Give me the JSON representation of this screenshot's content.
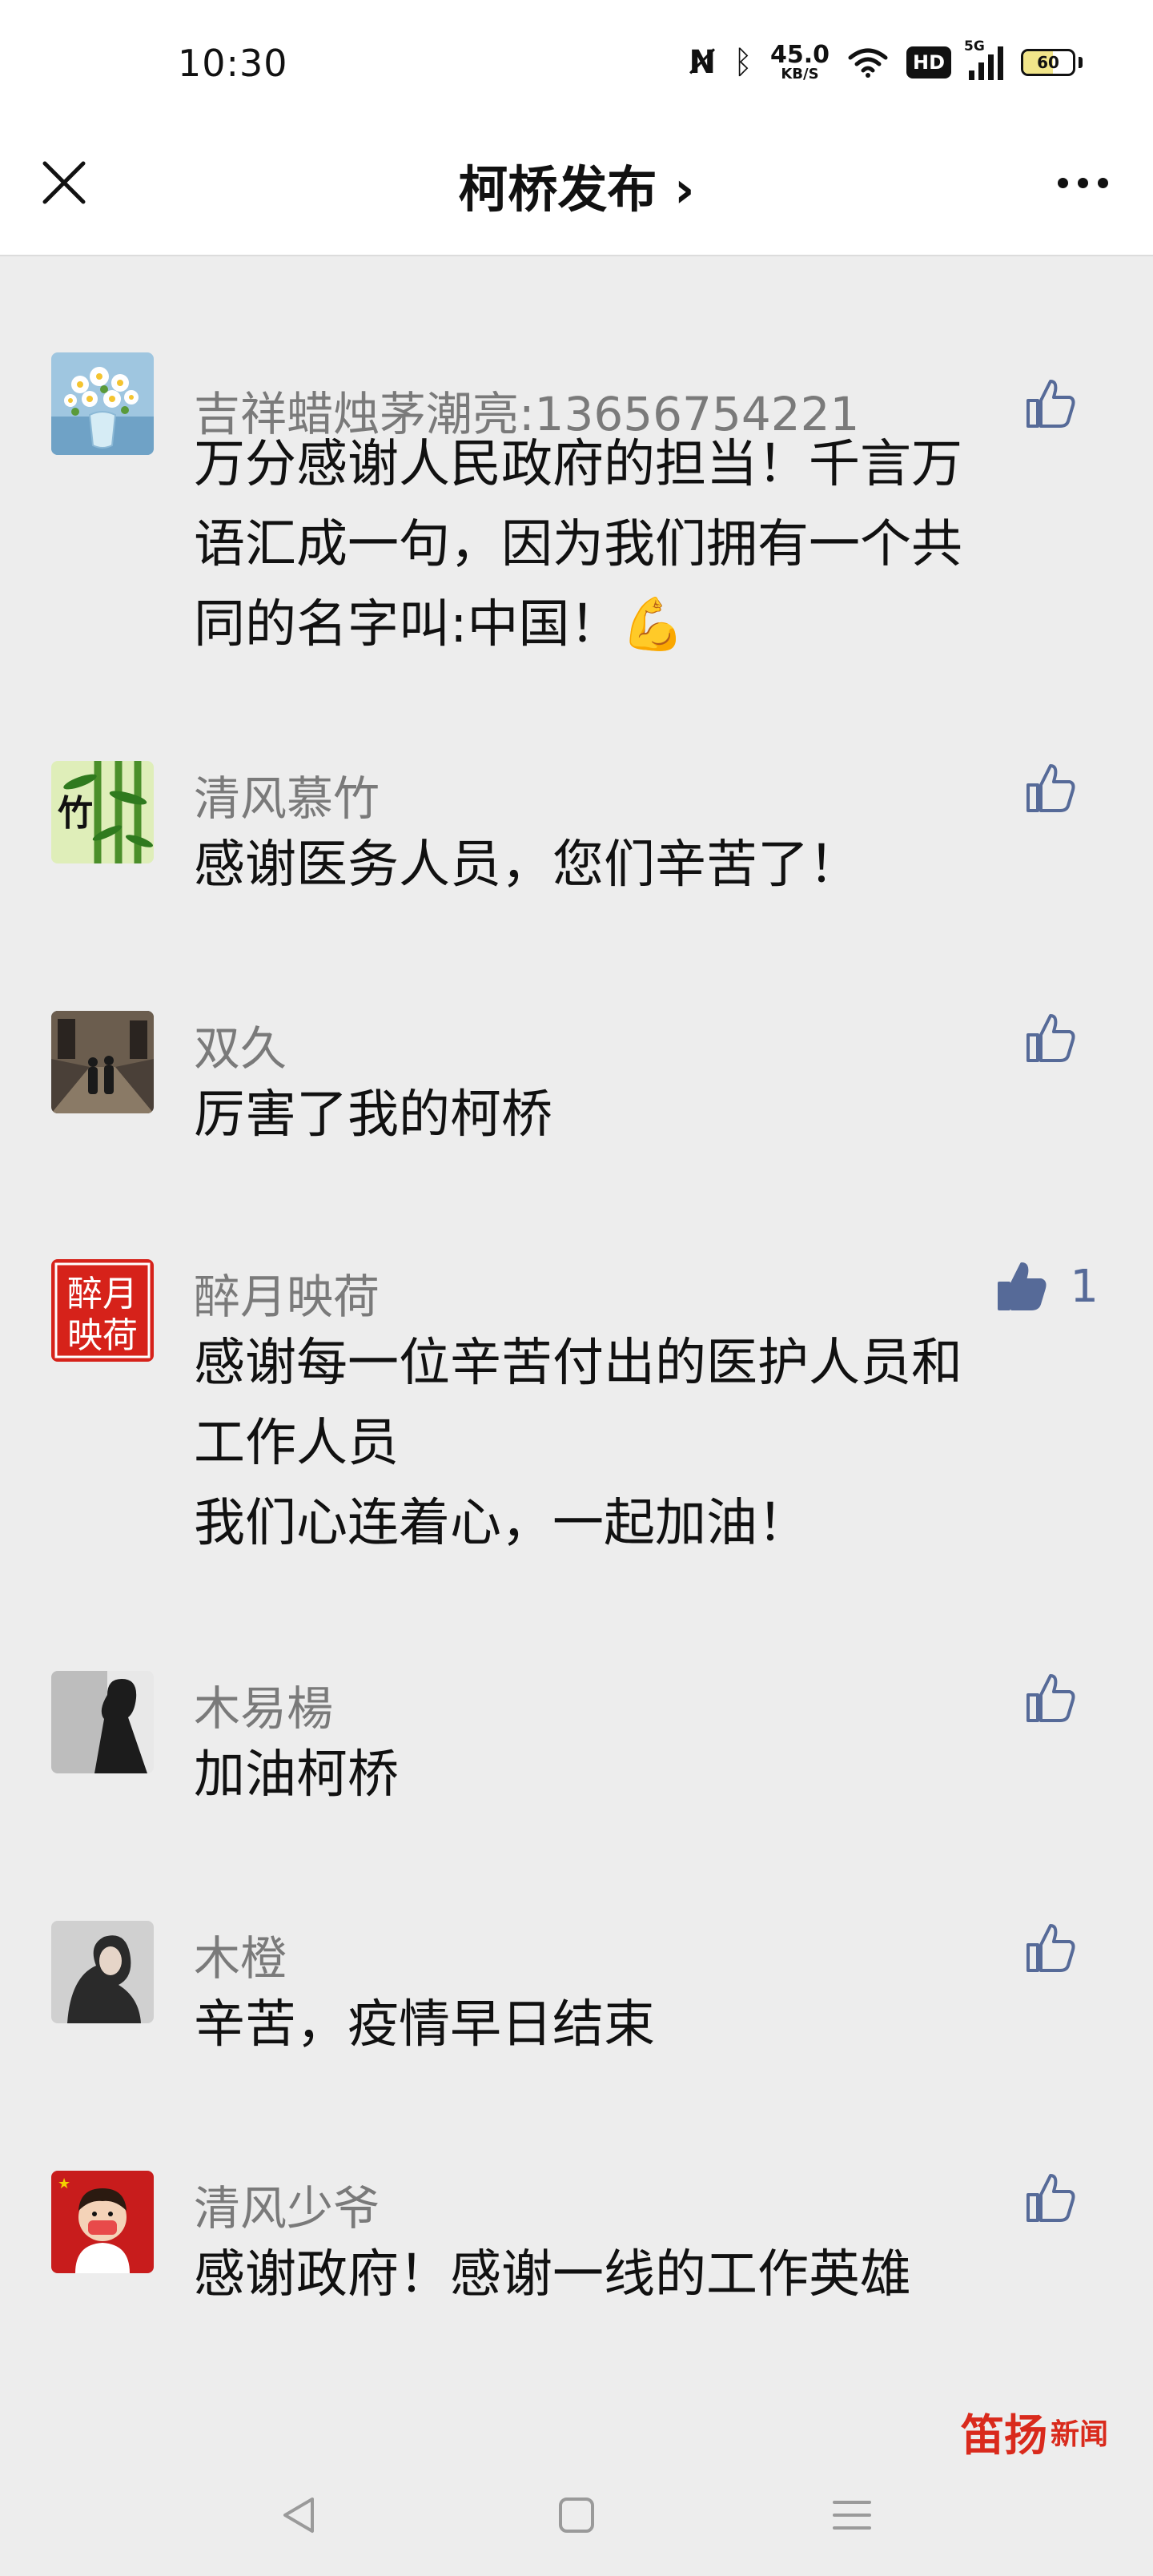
{
  "status_bar": {
    "time": "10:30",
    "net_speed_value": "45.0",
    "net_speed_unit": "KB/S",
    "hd_label": "HD",
    "signal_label": "5G",
    "battery_level": "60",
    "battery_color": "#f1e58a"
  },
  "header": {
    "title": "柯桥发布 ›"
  },
  "comments": [
    {
      "name": "吉祥蜡烛茅潮亮:13656754221",
      "text": "万分感谢人民政府的担当！千言万\n语汇成一句，因为我们拥有一个共\n同的名字叫:中国！💪",
      "liked": false,
      "like_count": ""
    },
    {
      "name": "清风慕竹",
      "text": "感谢医务人员，您们辛苦了！",
      "liked": false,
      "like_count": ""
    },
    {
      "name": "双久",
      "text": "厉害了我的柯桥",
      "liked": false,
      "like_count": ""
    },
    {
      "name": "醉月映荷",
      "text": "感谢每一位辛苦付出的医护人员和\n工作人员\n我们心连着心，一起加油！",
      "liked": true,
      "like_count": "1"
    },
    {
      "name": "木易楊",
      "text": "加油柯桥",
      "liked": false,
      "like_count": ""
    },
    {
      "name": "木橙",
      "text": "辛苦，疫情早日结束",
      "liked": false,
      "like_count": ""
    },
    {
      "name": "清风少爷",
      "text": "感谢政府！感谢一线的工作英雄",
      "liked": false,
      "like_count": ""
    }
  ],
  "avatars": {
    "seal_text": "醉月映荷"
  },
  "watermark": {
    "logo": "笛扬",
    "label": "新闻"
  },
  "colors": {
    "background": "#ededed",
    "like_icon": "#566a98",
    "name_text": "#7a7a7a"
  }
}
